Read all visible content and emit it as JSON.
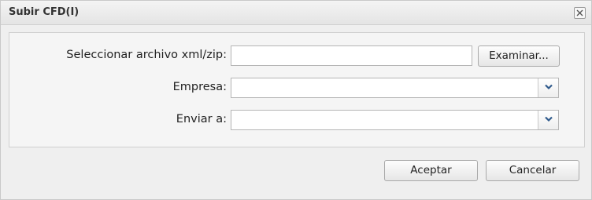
{
  "dialog": {
    "title": "Subir CFD(I)",
    "close_icon": "close-icon"
  },
  "form": {
    "file": {
      "label": "Seleccionar archivo xml/zip:",
      "value": "",
      "browse_label": "Examinar..."
    },
    "empresa": {
      "label": "Empresa:",
      "value": "",
      "arrow_icon": "chevron-down-icon"
    },
    "enviar": {
      "label": "Enviar a:",
      "value": "",
      "arrow_icon": "chevron-down-icon"
    }
  },
  "actions": {
    "accept_label": "Aceptar",
    "cancel_label": "Cancelar"
  },
  "colors": {
    "arrow": "#2f5a8c"
  }
}
